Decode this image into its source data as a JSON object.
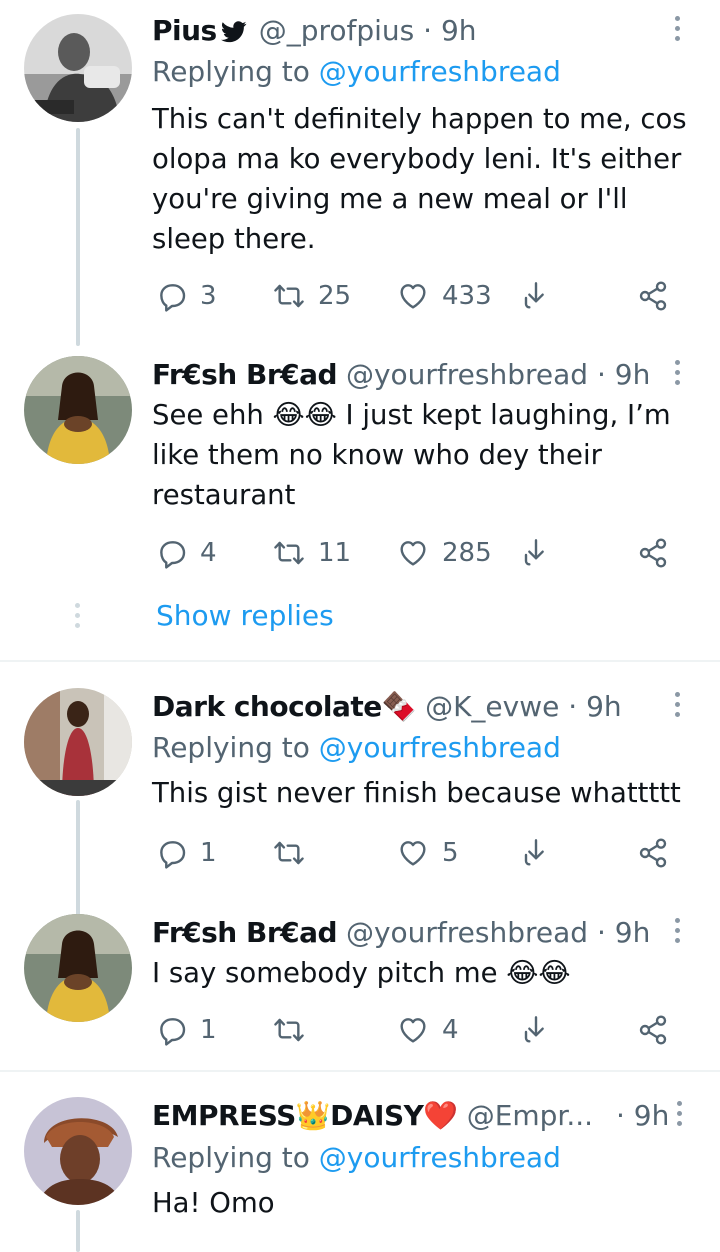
{
  "tweets": [
    {
      "name": "Pius",
      "handle": "@_profpius",
      "sep": "·",
      "time": "9h",
      "replying_label": "Replying to",
      "replying_handle": "@yourfreshbread",
      "text": "This can't definitely happen to me, cos olopa ma ko everybody leni. It's either you're giving me a new meal or I'll sleep there.",
      "replies": "3",
      "retweets": "25",
      "likes": "433"
    },
    {
      "name": "Fr€sh Br€ad",
      "handle": "@yourfreshbread",
      "sep": "·",
      "time": "9h",
      "text": "See ehh 😂😂 I just kept laughing, I’m like them no know who dey their restaurant",
      "replies": "4",
      "retweets": "11",
      "likes": "285"
    },
    {
      "name": "Dark chocolate🍫",
      "handle": "@K_evwe",
      "sep": "·",
      "time": "9h",
      "replying_label": "Replying to",
      "replying_handle": "@yourfreshbread",
      "text": "This gist never finish because whattttt",
      "replies": "1",
      "retweets": "",
      "likes": "5"
    },
    {
      "name": "Fr€sh Br€ad",
      "handle": "@yourfreshbread",
      "sep": "·",
      "time": "9h",
      "text": "I say somebody pitch me 😂😂",
      "replies": "1",
      "retweets": "",
      "likes": "4"
    },
    {
      "name": "EMPRESS👑DAISY❤️",
      "handle": "@Empr...",
      "sep": "·",
      "time": "9h",
      "replying_label": "Replying to",
      "replying_handle": "@yourfreshbread",
      "text": "Ha! Omo"
    }
  ],
  "show_replies": "Show replies",
  "icons": [
    "twitter-bird-icon",
    "more-icon",
    "reply-icon",
    "retweet-icon",
    "like-icon",
    "share-icon",
    "distribute-icon"
  ],
  "colors": {
    "link": "#1d9bf0",
    "muted": "#536471",
    "line": "#cfd9de",
    "text": "#0f1419"
  }
}
